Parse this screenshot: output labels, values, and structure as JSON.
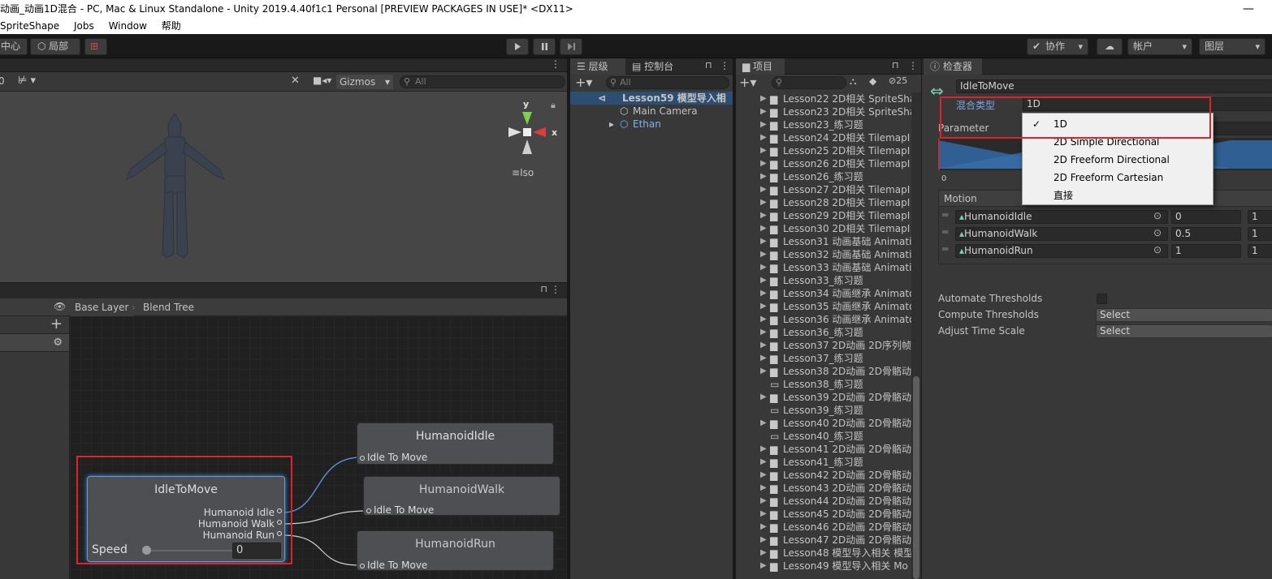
{
  "window": {
    "title": "动画_动画1D混合 - PC, Mac & Linux Standalone - Unity 2019.4.40f1c1 Personal [PREVIEW PACKAGES IN USE]* <DX11>",
    "minimize": "—"
  },
  "menu": [
    "SpriteShape",
    "Jobs",
    "Window",
    "帮助"
  ],
  "toolbar": {
    "pivot": "中心",
    "local": "局部",
    "collab": "协作",
    "account": "帐户",
    "layers": "图层"
  },
  "scene": {
    "toolbar_num": "0",
    "gizmos": "Gizmos",
    "search_placeholder": "All",
    "gizmo_y": "y",
    "gizmo_x": "x",
    "projection": "Iso"
  },
  "animator": {
    "breadcrumb": [
      "Base Layer",
      "Blend Tree"
    ],
    "blend_node": {
      "title": "IdleToMove",
      "outputs": [
        "Humanoid Idle",
        "Humanoid Walk",
        "Humanoid Run"
      ],
      "speed_label": "Speed",
      "speed_value": "0"
    },
    "motion_nodes": [
      {
        "title": "HumanoidIdle",
        "input": "Idle To Move"
      },
      {
        "title": "HumanoidWalk",
        "input": "Idle To Move"
      },
      {
        "title": "HumanoidRun",
        "input": "Idle To Move"
      }
    ]
  },
  "hierarchy": {
    "tab": "层级",
    "tab2": "控制台",
    "search_placeholder": "All",
    "scene": "Lesson59 模型导入相",
    "items": [
      "Main Camera",
      "Ethan"
    ]
  },
  "project": {
    "tab": "项目",
    "count": "25",
    "items": [
      {
        "label": "Lesson22 2D相关 SpriteSha",
        "arrow": true
      },
      {
        "label": "Lesson23 2D相关 SpriteSha",
        "arrow": true
      },
      {
        "label": "Lesson23_练习题",
        "arrow": true
      },
      {
        "label": "Lesson24 2D相关 TilemapI",
        "arrow": true
      },
      {
        "label": "Lesson25 2D相关 TilemapI",
        "arrow": true
      },
      {
        "label": "Lesson26 2D相关 TilemapI",
        "arrow": true
      },
      {
        "label": "Lesson26_练习题",
        "arrow": true
      },
      {
        "label": "Lesson27 2D相关 TilemapI",
        "arrow": true
      },
      {
        "label": "Lesson28 2D相关 TilemapI",
        "arrow": true
      },
      {
        "label": "Lesson29 2D相关 TilemapI",
        "arrow": true
      },
      {
        "label": "Lesson30 2D相关 TilemapI",
        "arrow": true
      },
      {
        "label": "Lesson31 动画基础 Animati",
        "arrow": true
      },
      {
        "label": "Lesson32 动画基础 Animati",
        "arrow": true
      },
      {
        "label": "Lesson33 动画基础 Animati",
        "arrow": true
      },
      {
        "label": "Lesson33_练习题",
        "arrow": true
      },
      {
        "label": "Lesson34 动画继承 Animato",
        "arrow": true
      },
      {
        "label": "Lesson35 动画继承 Animato",
        "arrow": true
      },
      {
        "label": "Lesson36 动画继承 Animato",
        "arrow": true
      },
      {
        "label": "Lesson36_练习题",
        "arrow": true
      },
      {
        "label": "Lesson37 2D动画 2D序列帧",
        "arrow": true
      },
      {
        "label": "Lesson37_练习题",
        "arrow": true
      },
      {
        "label": "Lesson38 2D动画 2D骨骼动",
        "arrow": true
      },
      {
        "label": "Lesson38_练习题",
        "arrow": false
      },
      {
        "label": "Lesson39 2D动画 2D骨骼动",
        "arrow": true
      },
      {
        "label": "Lesson39_练习题",
        "arrow": false
      },
      {
        "label": "Lesson40 2D动画 2D骨骼动",
        "arrow": true
      },
      {
        "label": "Lesson40_练习题",
        "arrow": false
      },
      {
        "label": "Lesson41 2D动画 2D骨骼动",
        "arrow": true
      },
      {
        "label": "Lesson41_练习题",
        "arrow": true
      },
      {
        "label": "Lesson42 2D动画 2D骨骼动",
        "arrow": true
      },
      {
        "label": "Lesson43 2D动画 2D骨骼动",
        "arrow": true
      },
      {
        "label": "Lesson44 2D动画 2D骨骼动",
        "arrow": true
      },
      {
        "label": "Lesson45 2D动画 2D骨骼动",
        "arrow": true
      },
      {
        "label": "Lesson46 2D动画 2D骨骼动",
        "arrow": true
      },
      {
        "label": "Lesson47 2D动画 2D骨骼动",
        "arrow": true
      },
      {
        "label": "Lesson48 模型导入相关 模型",
        "arrow": true
      },
      {
        "label": "Lesson49 模型导入相关 Mo",
        "arrow": true
      }
    ]
  },
  "inspector": {
    "tab": "检查器",
    "object_name": "IdleToMove",
    "blend_type_label": "混合类型",
    "blend_type_value": "1D",
    "parameter_label": "Parameter",
    "graph_min": "0",
    "motion_header": "Motion",
    "motions": [
      {
        "name": "HumanoidIdle",
        "threshold": "0",
        "speed": "1"
      },
      {
        "name": "HumanoidWalk",
        "threshold": "0.5",
        "speed": "1"
      },
      {
        "name": "HumanoidRun",
        "threshold": "1",
        "speed": "1"
      }
    ],
    "automate_label": "Automate Thresholds",
    "compute_label": "Compute Thresholds",
    "compute_value": "Select",
    "adjust_label": "Adjust Time Scale",
    "adjust_value": "Select",
    "dropdown": {
      "options": [
        "1D",
        "2D Simple Directional",
        "2D Freeform Directional",
        "2D Freeform Cartesian",
        "直接"
      ],
      "selected": "1D"
    }
  },
  "colors": {
    "highlight_red": "#e0232a",
    "accent_blue": "#4c7fbf",
    "graph_blue": "#2f5f93"
  }
}
